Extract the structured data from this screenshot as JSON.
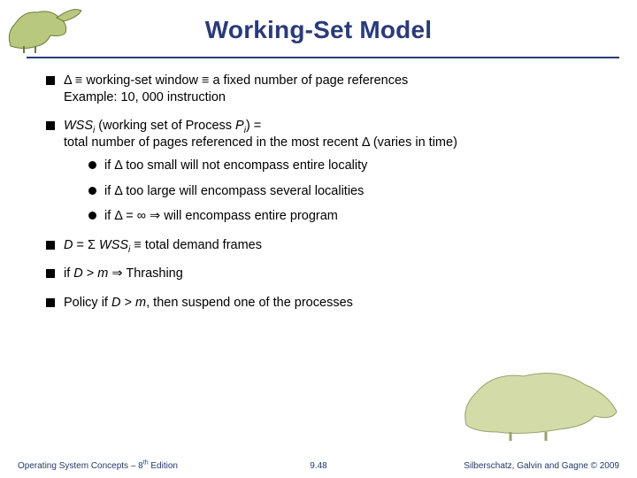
{
  "title": "Working-Set Model",
  "bullets": {
    "b1_line1": "Δ ≡ working-set window ≡ a fixed number of page references",
    "b1_line2": "Example:  10, 000 instruction",
    "b2_line1_prefix": "WSS",
    "b2_line1_mid": " (working set of Process ",
    "b2_line1_p": "P",
    "b2_line1_post": ") =",
    "b2_line2": "total number of pages referenced in the most recent Δ (varies in time)",
    "b2_sub1": "if Δ too small will not encompass entire locality",
    "b2_sub2": "if Δ too large will encompass several localities",
    "b2_sub3": "if Δ = ∞ ⇒ will encompass entire program",
    "b3_prefix": "D",
    "b3_mid": " = Σ ",
    "b3_wss": "WSS",
    "b3_post": " ≡ total demand frames",
    "b4_prefix": "if ",
    "b4_d": "D",
    "b4_gt": " > ",
    "b4_m": "m",
    "b4_post": " ⇒ Thrashing",
    "b5_prefix": "Policy if ",
    "b5_d": "D",
    "b5_gt": " > ",
    "b5_m": "m",
    "b5_post": ", then suspend one of the processes",
    "sub_i": "i"
  },
  "footer": {
    "left_main": "Operating System Concepts – 8",
    "left_sup": "th",
    "left_post": " Edition",
    "center": "9.48",
    "right": "Silberschatz, Galvin and Gagne © 2009"
  }
}
